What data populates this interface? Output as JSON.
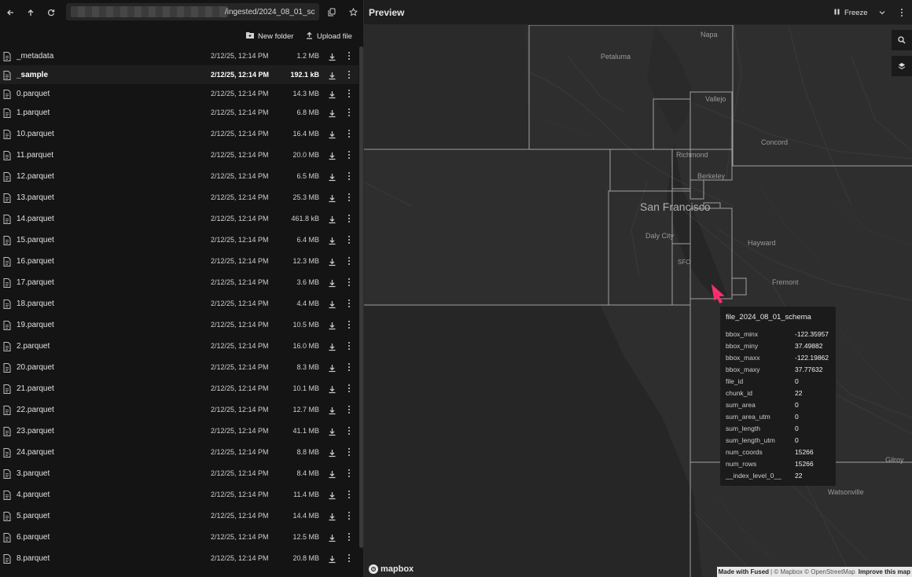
{
  "topbar": {
    "path_text": "/ingested/2024_08_01_sc",
    "back_icon": "arrow-left-icon",
    "up_icon": "arrow-up-icon",
    "refresh_icon": "refresh-icon"
  },
  "actions": {
    "new_folder": "New folder",
    "upload_file": "Upload file"
  },
  "files": [
    {
      "name": "_metadata",
      "date": "2/12/25, 12:14 PM",
      "size": "1.2 MB"
    },
    {
      "name": "_sample",
      "date": "2/12/25, 12:14 PM",
      "size": "192.1 kB"
    },
    {
      "name": "0.parquet",
      "date": "2/12/25, 12:14 PM",
      "size": "14.3 MB"
    },
    {
      "name": "1.parquet",
      "date": "2/12/25, 12:14 PM",
      "size": "6.8 MB"
    },
    {
      "name": "10.parquet",
      "date": "2/12/25, 12:14 PM",
      "size": "16.4 MB"
    },
    {
      "name": "11.parquet",
      "date": "2/12/25, 12:14 PM",
      "size": "20.0 MB"
    },
    {
      "name": "12.parquet",
      "date": "2/12/25, 12:14 PM",
      "size": "6.5 MB"
    },
    {
      "name": "13.parquet",
      "date": "2/12/25, 12:14 PM",
      "size": "25.3 MB"
    },
    {
      "name": "14.parquet",
      "date": "2/12/25, 12:14 PM",
      "size": "461.8 kB"
    },
    {
      "name": "15.parquet",
      "date": "2/12/25, 12:14 PM",
      "size": "6.4 MB"
    },
    {
      "name": "16.parquet",
      "date": "2/12/25, 12:14 PM",
      "size": "12.3 MB"
    },
    {
      "name": "17.parquet",
      "date": "2/12/25, 12:14 PM",
      "size": "3.6 MB"
    },
    {
      "name": "18.parquet",
      "date": "2/12/25, 12:14 PM",
      "size": "4.4 MB"
    },
    {
      "name": "19.parquet",
      "date": "2/12/25, 12:14 PM",
      "size": "10.5 MB"
    },
    {
      "name": "2.parquet",
      "date": "2/12/25, 12:14 PM",
      "size": "16.0 MB"
    },
    {
      "name": "20.parquet",
      "date": "2/12/25, 12:14 PM",
      "size": "8.3 MB"
    },
    {
      "name": "21.parquet",
      "date": "2/12/25, 12:14 PM",
      "size": "10.1 MB"
    },
    {
      "name": "22.parquet",
      "date": "2/12/25, 12:14 PM",
      "size": "12.7 MB"
    },
    {
      "name": "23.parquet",
      "date": "2/12/25, 12:14 PM",
      "size": "41.1 MB"
    },
    {
      "name": "24.parquet",
      "date": "2/12/25, 12:14 PM",
      "size": "8.8 MB"
    },
    {
      "name": "3.parquet",
      "date": "2/12/25, 12:14 PM",
      "size": "8.4 MB"
    },
    {
      "name": "4.parquet",
      "date": "2/12/25, 12:14 PM",
      "size": "11.4 MB"
    },
    {
      "name": "5.parquet",
      "date": "2/12/25, 12:14 PM",
      "size": "14.4 MB"
    },
    {
      "name": "6.parquet",
      "date": "2/12/25, 12:14 PM",
      "size": "12.5 MB"
    },
    {
      "name": "8.parquet",
      "date": "2/12/25, 12:14 PM",
      "size": "20.8 MB"
    }
  ],
  "highlighted_file": "_sample",
  "preview": {
    "title": "Preview",
    "freeze_label": "Freeze"
  },
  "map": {
    "places": {
      "napa": "Napa",
      "petaluma": "Petaluma",
      "vallejo": "Vallejo",
      "concord": "Concord",
      "richmond": "Richmond",
      "berkeley": "Berkeley",
      "san_francisco": "San Francisco",
      "daly_city": "Daly City",
      "hayward": "Hayward",
      "sfo": "SFO",
      "fremont": "Fremont",
      "gilroy": "Gilroy",
      "watsonville": "Watsonville"
    },
    "logo_text": "mapbox",
    "attribution": {
      "made_with": "Made with Fused",
      "copyright": "| © Mapbox © OpenStreetMap",
      "improve": "Improve this map"
    }
  },
  "tooltip": {
    "title": "file_2024_08_01_schema",
    "rows": [
      {
        "key": "bbox_minx",
        "value": "-122.35957"
      },
      {
        "key": "bbox_miny",
        "value": "37.49882"
      },
      {
        "key": "bbox_maxx",
        "value": "-122.19862"
      },
      {
        "key": "bbox_maxy",
        "value": "37.77632"
      },
      {
        "key": "file_id",
        "value": "0"
      },
      {
        "key": "chunk_id",
        "value": "22"
      },
      {
        "key": "sum_area",
        "value": "0"
      },
      {
        "key": "sum_area_utm",
        "value": "0"
      },
      {
        "key": "sum_length",
        "value": "0"
      },
      {
        "key": "sum_length_utm",
        "value": "0"
      },
      {
        "key": "num_coords",
        "value": "15266"
      },
      {
        "key": "num_rows",
        "value": "15266"
      },
      {
        "key": "__index_level_0__",
        "value": "22"
      }
    ]
  },
  "colors": {
    "cursor": "#ff2d6f",
    "map_bg": "#2b2b2b",
    "tile_outline": "#9a9a9a"
  }
}
